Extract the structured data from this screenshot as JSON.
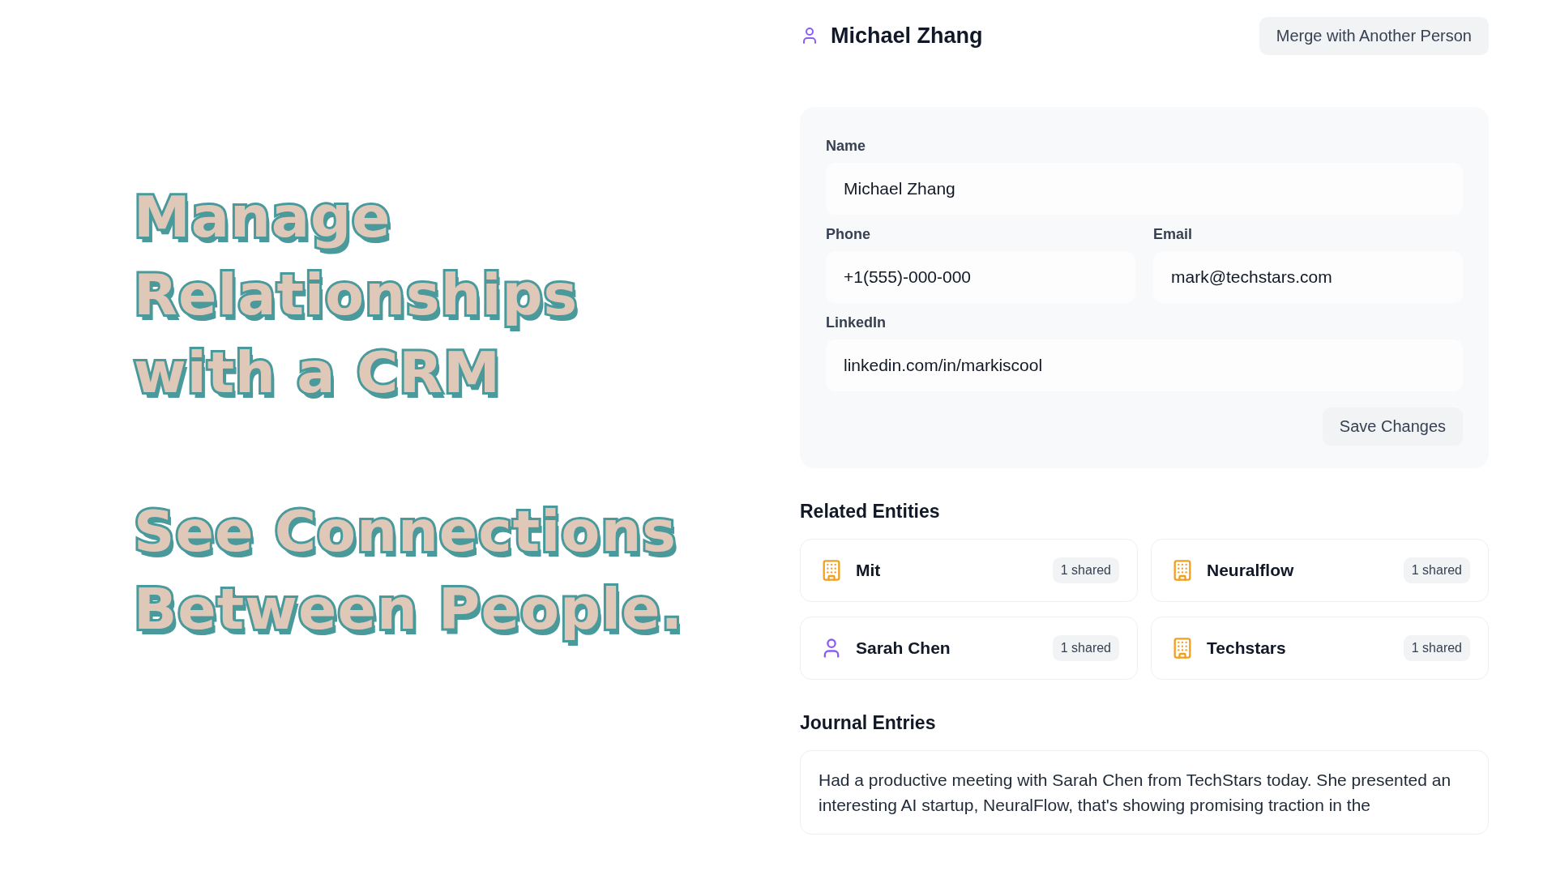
{
  "headline": [
    "Manage Relationships with a CRM",
    "See Connections Between People."
  ],
  "person": {
    "name": "Michael Zhang",
    "merge_button": "Merge with Another Person"
  },
  "form": {
    "fields": [
      {
        "label": "Name",
        "value": "Michael Zhang"
      },
      {
        "label": "Phone",
        "value": "+1(555)-000-000"
      },
      {
        "label": "Email",
        "value": "mark@techstars.com"
      },
      {
        "label": "LinkedIn",
        "value": "linkedin.com/in/markiscool"
      }
    ],
    "save_button": "Save Changes"
  },
  "related": {
    "title": "Related Entities",
    "items": [
      {
        "kind": "organization",
        "name": "Mit",
        "badge": "1 shared"
      },
      {
        "kind": "organization",
        "name": "Neuralflow",
        "badge": "1 shared"
      },
      {
        "kind": "person",
        "name": "Sarah Chen",
        "badge": "1 shared"
      },
      {
        "kind": "organization",
        "name": "Techstars",
        "badge": "1 shared"
      }
    ]
  },
  "journal": {
    "title": "Journal Entries",
    "entries": [
      "Had a productive meeting with Sarah Chen from TechStars today. She presented an interesting AI startup, NeuralFlow, that's showing promising traction in the"
    ]
  }
}
